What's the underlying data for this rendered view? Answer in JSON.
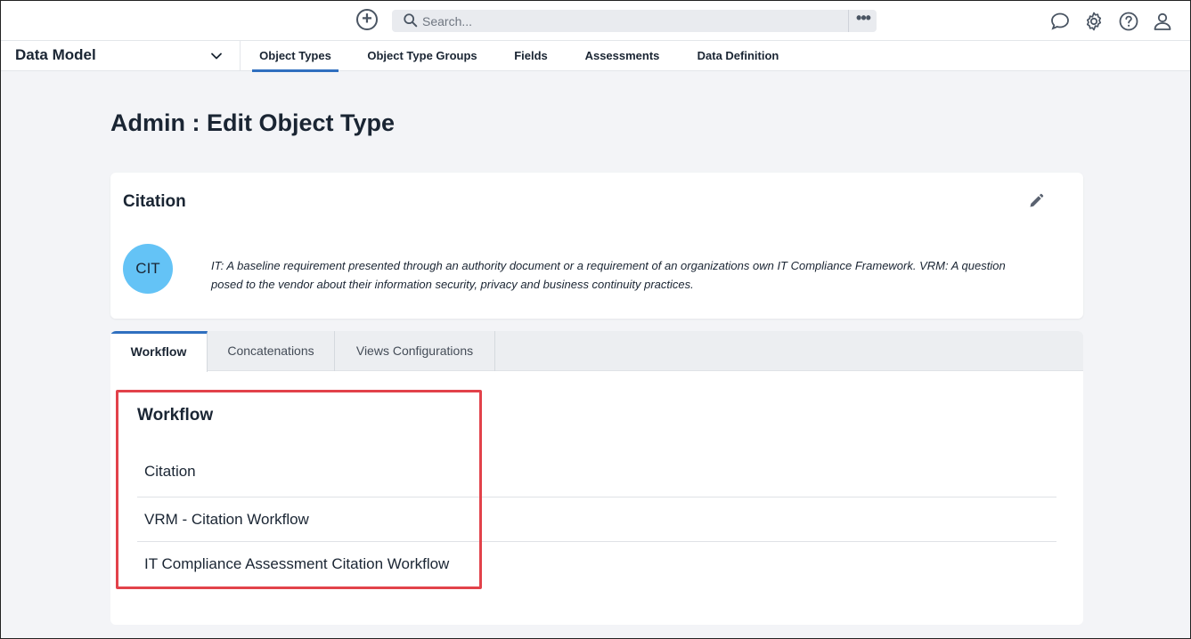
{
  "topbar": {
    "add_icon": "plus-circle-icon",
    "search_placeholder": "Search...",
    "more_icon": "ellipsis-icon",
    "icons": [
      "chat-bubble-icon",
      "gear-icon",
      "help-icon",
      "user-icon"
    ]
  },
  "nav": {
    "app_title": "Data Model",
    "tabs": [
      {
        "label": "Object Types",
        "active": true
      },
      {
        "label": "Object Type Groups",
        "active": false
      },
      {
        "label": "Fields",
        "active": false
      },
      {
        "label": "Assessments",
        "active": false
      },
      {
        "label": "Data Definition",
        "active": false
      }
    ]
  },
  "page": {
    "title": "Admin : Edit Object Type"
  },
  "object_type": {
    "name": "Citation",
    "avatar_text": "CIT",
    "description": "IT: A baseline requirement presented through an authority document or a requirement of an organizations own IT Compliance Framework. VRM: A question posed to the vendor about their information security, privacy and business continuity practices."
  },
  "tabs": [
    {
      "label": "Workflow",
      "active": true
    },
    {
      "label": "Concatenations",
      "active": false
    },
    {
      "label": "Views Configurations",
      "active": false
    }
  ],
  "workflow": {
    "title": "Workflow",
    "items": [
      "Citation",
      "VRM - Citation Workflow",
      "IT Compliance Assessment Citation Workflow"
    ]
  },
  "colors": {
    "accent": "#2f6fbf",
    "avatar": "#64c3f6",
    "highlight": "#e2424a",
    "background": "#f3f4f7"
  }
}
